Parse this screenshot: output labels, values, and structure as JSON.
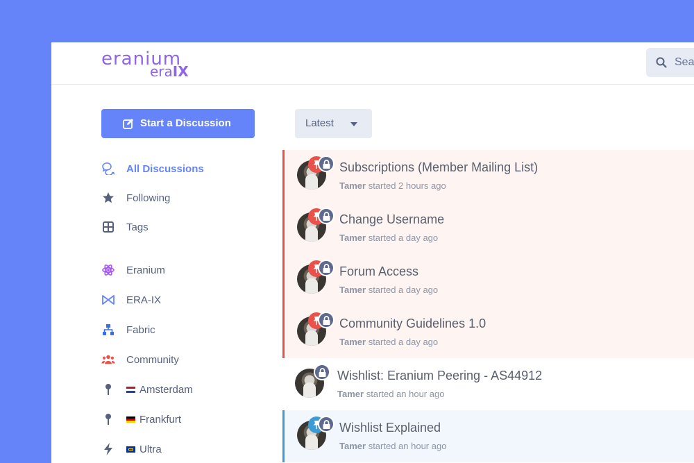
{
  "logo": {
    "line1": "eranium",
    "line2a": "era",
    "line2b": "IX"
  },
  "search": {
    "placeholder": "Search"
  },
  "start_discussion": "Start a Discussion",
  "sort": {
    "selected": "Latest"
  },
  "nav": [
    {
      "label": "All Discussions",
      "icon": "comments-icon",
      "active": true
    },
    {
      "label": "Following",
      "icon": "star-icon"
    },
    {
      "label": "Tags",
      "icon": "tags-grid-icon"
    },
    {
      "label": "Eranium",
      "icon": "atom-icon",
      "color": "#a855f7"
    },
    {
      "label": "ERA-IX",
      "icon": "bowtie-icon",
      "color": "#6584f9"
    },
    {
      "label": "Fabric",
      "icon": "network-icon",
      "color": "#3b6ee8"
    },
    {
      "label": "Community",
      "icon": "users-icon",
      "color": "#e8524a"
    },
    {
      "label": "Amsterdam",
      "icon": "map-pin-icon",
      "flag": "netherlands-flag"
    },
    {
      "label": "Frankfurt",
      "icon": "map-pin-icon",
      "flag": "germany-flag"
    },
    {
      "label": "Ultra",
      "icon": "bolt-icon",
      "flag": "eu-flag"
    }
  ],
  "discussions": [
    {
      "title": "Subscriptions (Member Mailing List)",
      "author": "Tamer",
      "when": "started 2 hours ago",
      "style": "sticky"
    },
    {
      "title": "Change Username",
      "author": "Tamer",
      "when": "started a day ago",
      "style": "sticky"
    },
    {
      "title": "Forum Access",
      "author": "Tamer",
      "when": "started a day ago",
      "style": "sticky"
    },
    {
      "title": "Community Guidelines 1.0",
      "author": "Tamer",
      "when": "started a day ago",
      "style": "sticky"
    },
    {
      "title": "Wishlist: Eranium Peering - AS44912",
      "author": "Tamer",
      "when": "started an hour ago",
      "style": "plain"
    },
    {
      "title": "Wishlist Explained",
      "author": "Tamer",
      "when": "started an hour ago",
      "style": "blue"
    }
  ],
  "colors": {
    "accent": "#6584f9",
    "sticky": "#e8524a",
    "pinned": "#3c9bd4"
  }
}
